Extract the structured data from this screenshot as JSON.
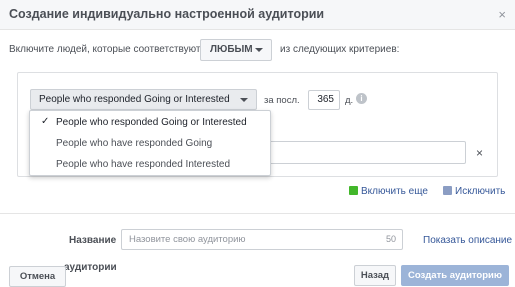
{
  "dialog": {
    "title": "Создание индивидуально настроенной аудитории",
    "close_icon": "×"
  },
  "criteria": {
    "prefix": "Включите людей, которые соответствуют",
    "match_value": "ЛЮБЫМ",
    "suffix": "из следующих критериев:"
  },
  "rule": {
    "event_selected": "People who responded Going or Interested",
    "period_label": "за посл.",
    "days": "365",
    "days_unit": "д.",
    "info_icon": "i"
  },
  "menu": {
    "items": [
      {
        "label": "People who responded Going or Interested",
        "selected": true
      },
      {
        "label": "People who have responded Going",
        "selected": false
      },
      {
        "label": "People who have responded Interested",
        "selected": false
      }
    ],
    "check_icon": "✓"
  },
  "links": {
    "include": "Включить еще",
    "exclude": "Исключить",
    "show_description": "Показать описание"
  },
  "name_field": {
    "label": "Название",
    "placeholder": "Назовите свою аудиторию",
    "char_limit": "50"
  },
  "audience_label": "аудитории",
  "remove_icon": "×",
  "buttons": {
    "cancel": "Отмена",
    "back": "Назад",
    "create": "Создать аудиторию"
  },
  "colors": {
    "link": "#365899",
    "include_icon": "#42b72a",
    "exclude_icon": "#8b9dc3",
    "primary_disabled": "#9cb4d8"
  }
}
